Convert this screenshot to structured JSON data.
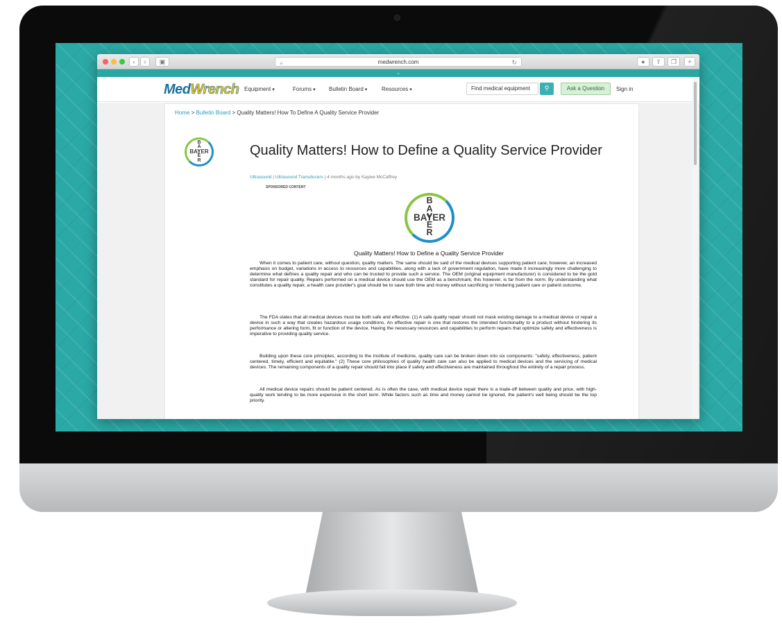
{
  "browser": {
    "url": "medwrench.com",
    "expand_icon": "chevron-double-down-icon"
  },
  "site": {
    "logo": {
      "part1": "Med",
      "part2": "Wrench"
    },
    "nav": [
      {
        "label": "Equipment"
      },
      {
        "label": "Forums"
      },
      {
        "label": "Bulletin Board"
      },
      {
        "label": "Resources"
      }
    ],
    "search": {
      "value": "Find medical equipment"
    },
    "ask_button": "Ask a Question",
    "sign_in": "Sign in"
  },
  "breadcrumb": {
    "home": "Home",
    "sep1": " > ",
    "bulletin": "Bulletin Board",
    "sep2": " > ",
    "current": "Quality Matters! How To Define A Quality Service Provider"
  },
  "article": {
    "title": "Quality Matters! How to Define a Quality Service Provider",
    "category1": "Ultrasound",
    "category2": "Ultrasound Transducers",
    "meta_sep": "  |  ",
    "time": "4 months ago",
    "by": " by ",
    "author": "Kaylee McCaffrey",
    "sponsored": "SPONSORED CONTENT",
    "logo_text": {
      "horizontal": "BAYER",
      "vertical": [
        "B",
        "A",
        "Y",
        "E",
        "R"
      ]
    },
    "doc_title": "Quality Matters!  How to Define a Quality Service Provider",
    "paragraphs": [
      "When it comes to patient care, without question, quality matters. The same should be said of the medical devices supporting patient care; however, an increased emphasis on budget, variations in access to resources and capabilities, along with a lack of government regulation, have made it increasingly more challenging to determine what defines a quality repair and who can be trusted to provide such a service. The OEM (original equipment manufacturer) is considered to be the gold standard for repair quality. Repairs performed on a medical device should use the OEM as a benchmark; this however, is far from the norm. By understanding what constitutes a quality repair, a health care provider's goal should be to save both time and money without sacrificing or hindering patient care or patient outcome.",
      "The FDA states that all medical devices must be both safe and effective. (1) A safe quality repair should not mask existing damage to a medical device or repair a device in such a way that creates hazardous usage conditions.   An effective repair is one that restores the intended functionality to a product without hindering its performance or altering form, fit or function of the device. Having the necessary resources and capabilities to perform repairs that optimize safety and effectiveness is imperative to providing quality service.",
      "Building upon these core principles, according to the Institute of medicine, quality care can be broken down into six components: \"safety, effectiveness, patient centered, timely, efficient and equitable.\" (2)  These core philosophies of quality health care can also be applied to medical devices and the servicing of medical devices.  The remaining components of a quality repair should fall into place if safety and effectiveness are maintained throughout the entirety of a repair process.",
      "All medical device repairs should be patient centered. As is often the case, with medical device repair there is a trade-off between quality and price, with high-quality work tending to be more expensive in the short term. While factors such as time and money cannot be ignored, the patient's well being should be the top priority."
    ]
  }
}
